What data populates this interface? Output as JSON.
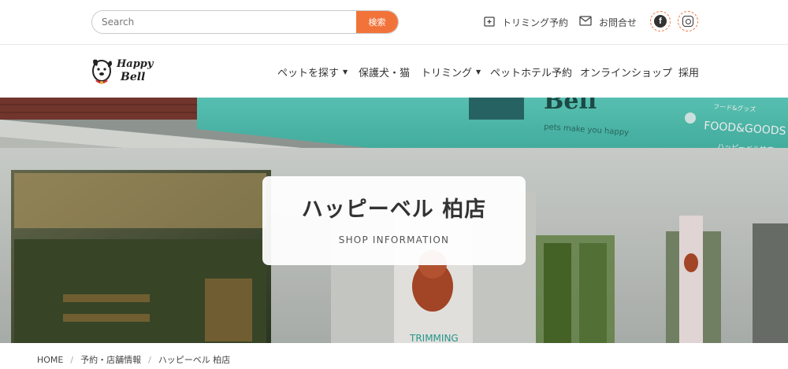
{
  "search": {
    "placeholder": "Search",
    "button_label": "検索"
  },
  "utility": {
    "trimming_reserve": "トリミング予約",
    "contact": "お問合せ"
  },
  "social": [
    {
      "icon": "facebook-icon"
    },
    {
      "icon": "instagram-icon"
    }
  ],
  "logo": {
    "line1": "Happy",
    "line2": "Bell"
  },
  "nav": [
    {
      "label": "ペットを探す",
      "has_dropdown": true
    },
    {
      "label": "保護犬・猫",
      "has_dropdown": false
    },
    {
      "label": "トリミング",
      "has_dropdown": true
    },
    {
      "label": "ペットホテル予約",
      "has_dropdown": false
    },
    {
      "label": "オンラインショップ",
      "has_dropdown": false
    },
    {
      "label": "採用",
      "has_dropdown": false
    }
  ],
  "hero": {
    "title": "ハッピーベル 柏店",
    "subtitle": "SHOP INFORMATION",
    "sign": {
      "brand": "Bell",
      "tagline": "pets make you happy",
      "food_small": "フード&グッズ",
      "food": "FOOD&GOODS",
      "store": "ハッピーベル柏店",
      "trimming": "TRIMMING"
    }
  },
  "breadcrumb": {
    "home": "HOME",
    "section": "予約・店舗情報",
    "current": "ハッピーベル 柏店"
  },
  "colors": {
    "accent": "#f2733a",
    "sign_teal": "#44bfb0"
  }
}
